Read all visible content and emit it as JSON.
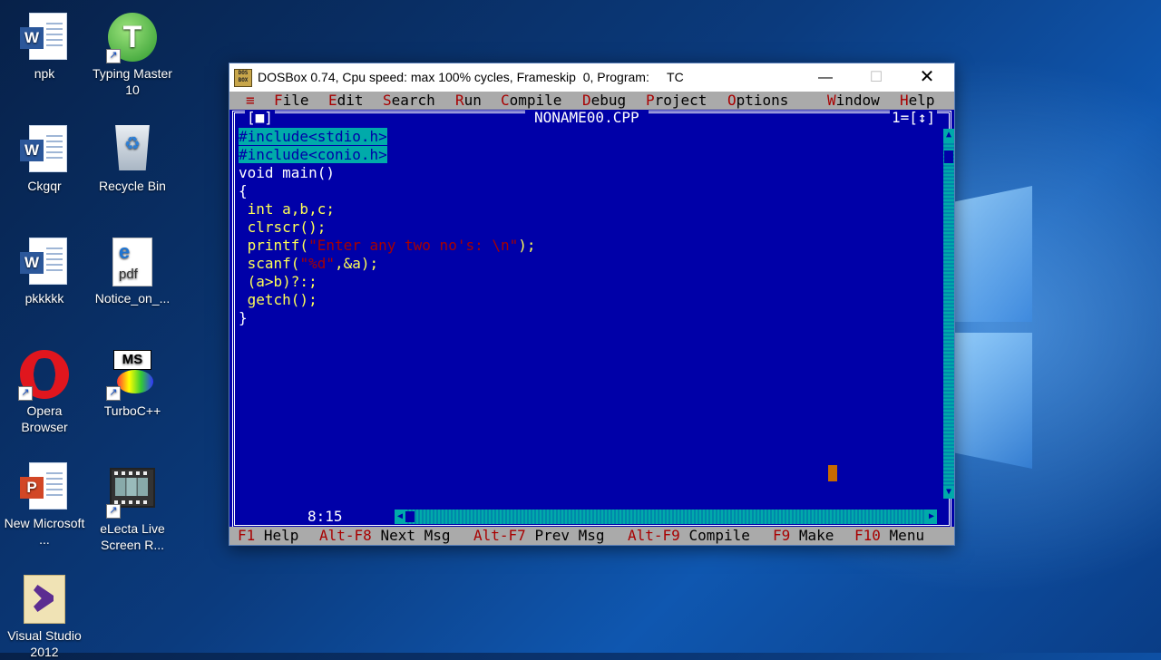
{
  "desktop": {
    "icons": [
      {
        "label": "npk"
      },
      {
        "label": "Typing Master 10"
      },
      {
        "label": "Ckgqr"
      },
      {
        "label": "Recycle Bin"
      },
      {
        "label": "pkkkkk"
      },
      {
        "label": "Notice_on_..."
      },
      {
        "label": "Opera Browser"
      },
      {
        "label": "TurboC++"
      },
      {
        "label": "New Microsoft ..."
      },
      {
        "label": "eLecta Live Screen R..."
      },
      {
        "label": "Visual Studio 2012"
      }
    ]
  },
  "window": {
    "title": "DOSBox 0.74, Cpu speed: max 100% cycles, Frameskip  0, Program:     TC",
    "icon_text": "DOS BOX",
    "minimize": "—",
    "maximize": "☐",
    "close": "✕"
  },
  "menu": {
    "items": [
      {
        "hot": "≡",
        "rest": ""
      },
      {
        "hot": "F",
        "rest": "ile"
      },
      {
        "hot": "E",
        "rest": "dit"
      },
      {
        "hot": "S",
        "rest": "earch"
      },
      {
        "hot": "R",
        "rest": "un"
      },
      {
        "hot": "C",
        "rest": "ompile"
      },
      {
        "hot": "D",
        "rest": "ebug"
      },
      {
        "hot": "P",
        "rest": "roject"
      },
      {
        "hot": "O",
        "rest": "ptions"
      },
      {
        "hot": "W",
        "rest": "indow"
      },
      {
        "hot": "H",
        "rest": "elp"
      }
    ]
  },
  "editor": {
    "filename": "NONAME00.CPP",
    "close_box": "[■]",
    "window_number": "1=[↕]",
    "cursor_position": "8:15",
    "lines": [
      "#include<stdio.h>",
      "#include<conio.h>",
      "void main()",
      "{",
      " int a,b,c;",
      " clrscr();",
      " printf(\"Enter any two no's: \\n\");",
      " scanf(\"%d\",&a);",
      " (a>b)?:;",
      " getch();",
      "}"
    ]
  },
  "statusbar": {
    "items": [
      {
        "key": "F1",
        "label": "Help"
      },
      {
        "key": "Alt-F8",
        "label": "Next Msg"
      },
      {
        "key": "Alt-F7",
        "label": "Prev Msg"
      },
      {
        "key": "Alt-F9",
        "label": "Compile"
      },
      {
        "key": "F9",
        "label": "Make"
      },
      {
        "key": "F10",
        "label": "Menu"
      }
    ]
  },
  "colors": {
    "dos_blue": "#0000a8",
    "dos_gray": "#aaaaaa",
    "hotkey_red": "#a80000",
    "selection_cyan": "#00aaaa",
    "code_yellow": "#ffff55"
  }
}
